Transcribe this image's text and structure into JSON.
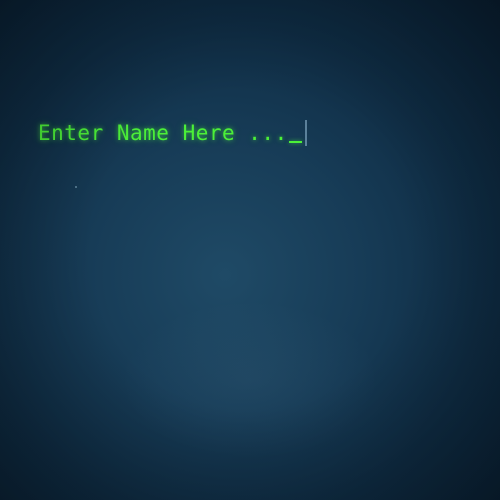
{
  "terminal": {
    "prompt_text": "Enter Name Here ...",
    "cursor_glyph": "_"
  },
  "colors": {
    "text": "#4cf038",
    "background": "#173c57"
  }
}
